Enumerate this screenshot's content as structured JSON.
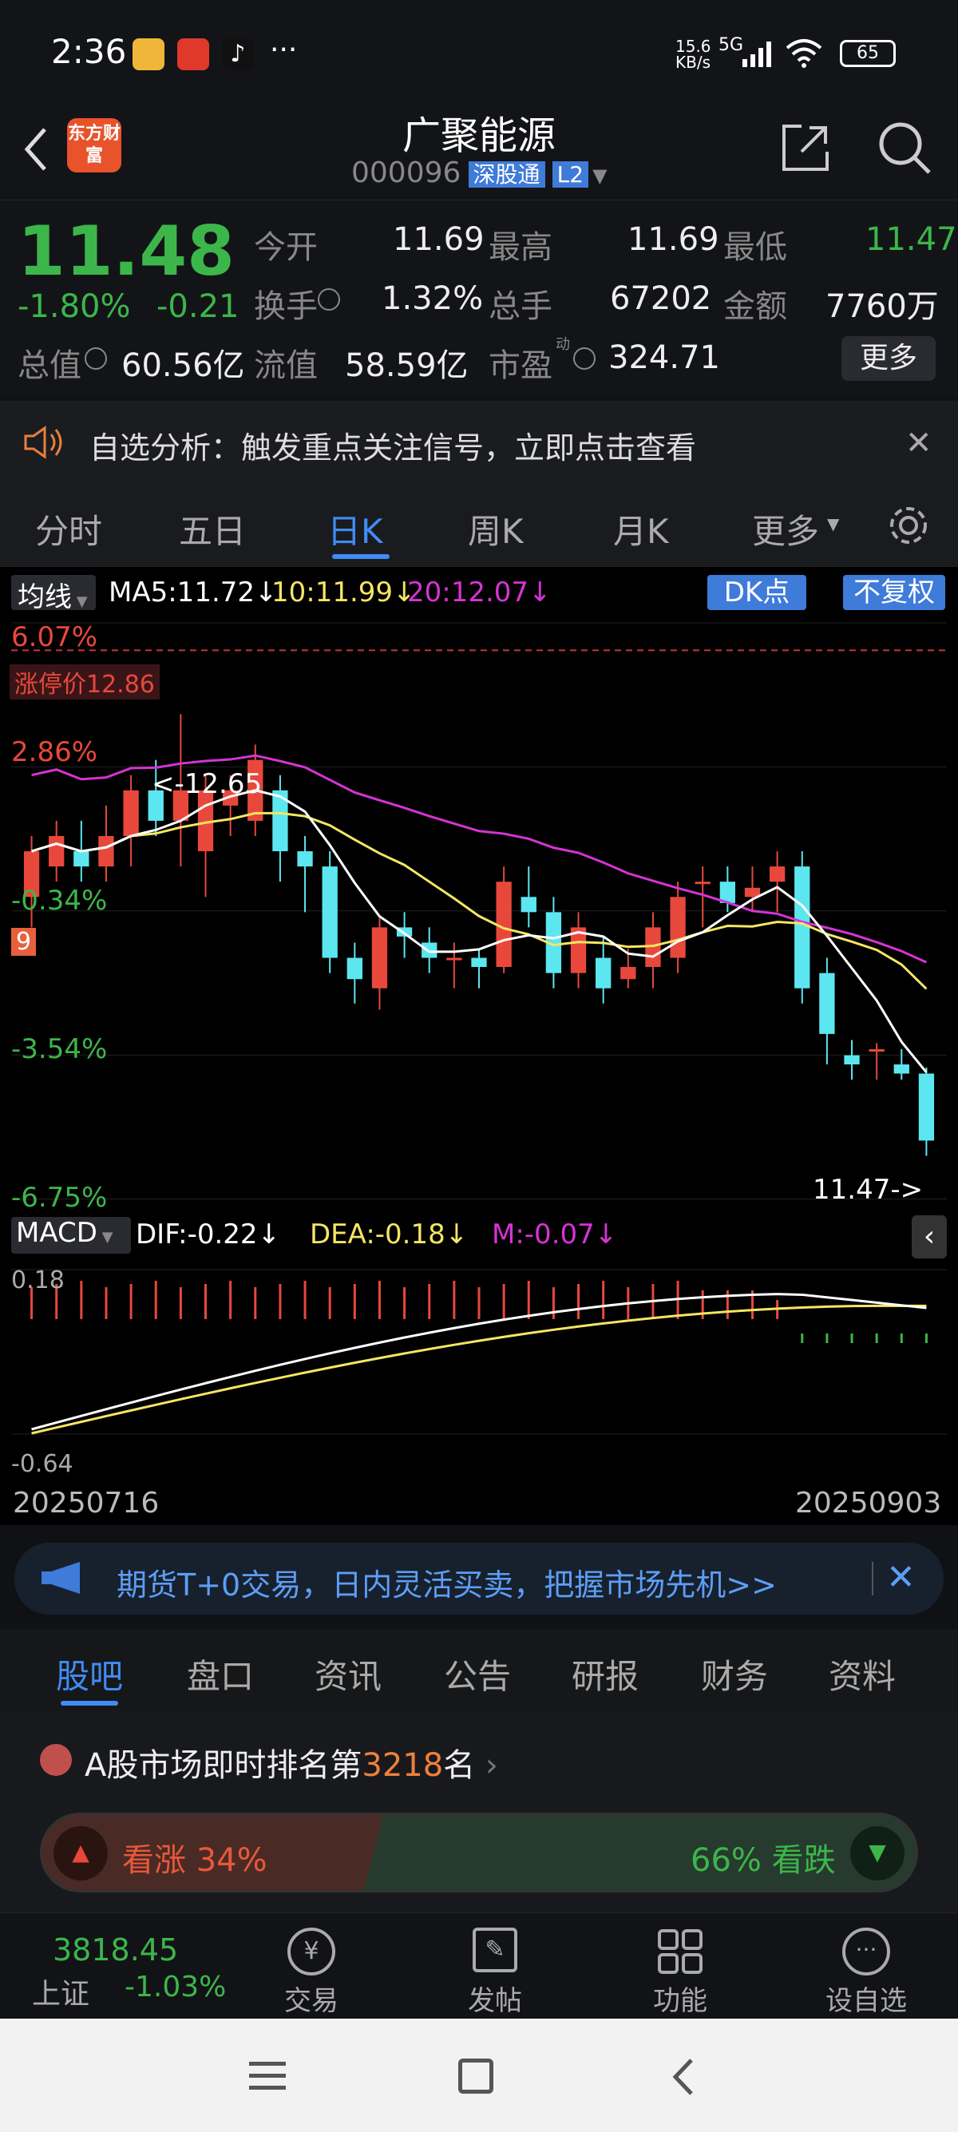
{
  "status_bar": {
    "time": "2:36",
    "net_speed": "15.6 KB/s",
    "network": "5G",
    "battery": "65"
  },
  "header": {
    "title": "广聚能源",
    "code": "000096",
    "badge_sgt": "深股通",
    "badge_l2": "L2",
    "app_logo": "东方财富"
  },
  "quote": {
    "price": "11.48",
    "change_pct": "-1.80%",
    "change": "-0.21",
    "open_label": "今开",
    "open": "11.69",
    "high_label": "最高",
    "high": "11.69",
    "low_label": "最低",
    "low": "11.47",
    "turnover_label": "换手",
    "turnover": "1.32%",
    "volume_label": "总手",
    "volume": "67202",
    "amount_label": "金额",
    "amount": "7760万",
    "mcap_label": "总值",
    "mcap": "60.56亿",
    "float_label": "流值",
    "float": "58.59亿",
    "pe_label": "市盈",
    "pe_sup": "动",
    "pe": "324.71",
    "more": "更多"
  },
  "alert": {
    "text": "自选分析：触发重点关注信号，立即点击查看"
  },
  "chart_tabs": [
    "分时",
    "五日",
    "日K",
    "周K",
    "月K",
    "更多"
  ],
  "active_tab": "日K",
  "ma_bar": {
    "selector": "均线",
    "ma5": "MA5:11.72",
    "ma10": "10:11.99",
    "ma20": "20:12.07",
    "dk": "DK点",
    "adjust": "不复权"
  },
  "chart_labels": {
    "top_pct": "6.07%",
    "limit_up": "涨停价12.86",
    "p1": "2.86%",
    "p2": "-0.34%",
    "p3": "-3.54%",
    "p4": "-6.75%",
    "max_marker": "<-12.65",
    "min_marker": "11.47->",
    "nine": "9"
  },
  "macd_bar": {
    "selector": "MACD",
    "dif": "DIF:-0.22",
    "dea": "DEA:-0.18",
    "m": "M:-0.07",
    "top": "0.18",
    "bottom": "-0.64"
  },
  "dates": {
    "start": "20250716",
    "end": "20250903"
  },
  "ad": {
    "text": "期货T+0交易，日内灵活买卖，把握市场先机>>"
  },
  "section_tabs": [
    "股吧",
    "盘口",
    "资讯",
    "公告",
    "研报",
    "财务",
    "资料"
  ],
  "rank": {
    "prefix": "A股市场即时排名第",
    "rank": "3218",
    "suffix": "名",
    "up_label": "看涨 34%",
    "down_label": "66% 看跌",
    "up_pct": 34
  },
  "bottom": {
    "index_value": "3818.45",
    "index_name": "上证",
    "index_change": "-1.03%",
    "items": [
      "交易",
      "发帖",
      "功能",
      "设自选"
    ]
  },
  "colors": {
    "up": "#e8483b",
    "down": "#5ce6f0",
    "ma5": "#ffffff",
    "ma10": "#f5e663",
    "ma20": "#d633d6",
    "blue": "#3f7bd9"
  },
  "chart_data": {
    "type": "candlestick",
    "ylim": [
      10.8,
      12.95
    ],
    "candles": [
      [
        12.05,
        12.2,
        12.25,
        11.95
      ],
      [
        12.15,
        12.25,
        12.3,
        12.1
      ],
      [
        12.2,
        12.15,
        12.3,
        12.1
      ],
      [
        12.15,
        12.25,
        12.35,
        12.1
      ],
      [
        12.25,
        12.4,
        12.45,
        12.15
      ],
      [
        12.4,
        12.3,
        12.5,
        12.25
      ],
      [
        12.3,
        12.4,
        12.65,
        12.15
      ],
      [
        12.2,
        12.4,
        12.45,
        12.05
      ],
      [
        12.35,
        12.4,
        12.45,
        12.25
      ],
      [
        12.3,
        12.5,
        12.55,
        12.25
      ],
      [
        12.4,
        12.2,
        12.45,
        12.1
      ],
      [
        12.2,
        12.15,
        12.25,
        12.0
      ],
      [
        12.15,
        11.85,
        12.2,
        11.8
      ],
      [
        11.85,
        11.78,
        11.9,
        11.7
      ],
      [
        11.75,
        11.95,
        11.98,
        11.68
      ],
      [
        11.95,
        11.92,
        12.0,
        11.85
      ],
      [
        11.9,
        11.85,
        11.95,
        11.8
      ],
      [
        11.85,
        11.85,
        11.9,
        11.75
      ],
      [
        11.85,
        11.82,
        11.88,
        11.75
      ],
      [
        11.82,
        12.1,
        12.15,
        11.8
      ],
      [
        12.05,
        12.0,
        12.15,
        11.95
      ],
      [
        12.0,
        11.8,
        12.05,
        11.75
      ],
      [
        11.8,
        11.95,
        12.0,
        11.75
      ],
      [
        11.85,
        11.75,
        11.92,
        11.7
      ],
      [
        11.78,
        11.82,
        11.88,
        11.75
      ],
      [
        11.82,
        11.95,
        12.0,
        11.75
      ],
      [
        11.85,
        12.05,
        12.1,
        11.8
      ],
      [
        12.1,
        12.1,
        12.15,
        11.95
      ],
      [
        12.1,
        12.03,
        12.15,
        12.0
      ],
      [
        12.05,
        12.08,
        12.15,
        12.0
      ],
      [
        12.1,
        12.15,
        12.2,
        12.0
      ],
      [
        12.15,
        11.75,
        12.2,
        11.7
      ],
      [
        11.8,
        11.6,
        11.85,
        11.5
      ],
      [
        11.53,
        11.5,
        11.58,
        11.45
      ],
      [
        11.55,
        11.55,
        11.57,
        11.45
      ],
      [
        11.5,
        11.47,
        11.55,
        11.45
      ],
      [
        11.47,
        11.25,
        11.49,
        11.2
      ]
    ]
  }
}
